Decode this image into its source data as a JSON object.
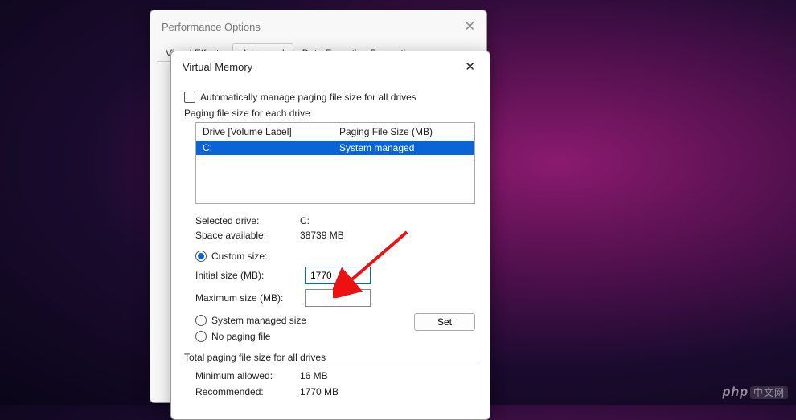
{
  "perf_window": {
    "title": "Performance Options",
    "tabs": [
      "Visual Effects",
      "Advanced",
      "Data Execution Prevention"
    ],
    "active_tab": 1
  },
  "vm_window": {
    "title": "Virtual Memory",
    "auto_manage_label": "Automatically manage paging file size for all drives",
    "group_label": "Paging file size for each drive",
    "header_drive": "Drive  [Volume Label]",
    "header_size": "Paging File Size (MB)",
    "drives": [
      {
        "drive": "C:",
        "size": "System managed",
        "selected": true
      }
    ],
    "selected_drive_label": "Selected drive:",
    "selected_drive_value": "C:",
    "space_label": "Space available:",
    "space_value": "38739 MB",
    "radio_custom": "Custom size:",
    "initial_label": "Initial size (MB):",
    "initial_value": "1770",
    "max_label": "Maximum size (MB):",
    "max_value": "",
    "radio_system": "System managed size",
    "radio_none": "No paging file",
    "set_btn": "Set",
    "total_label": "Total paging file size for all drives",
    "min_allowed_label": "Minimum allowed:",
    "min_allowed_value": "16 MB",
    "recommended_label": "Recommended:",
    "recommended_value": "1770 MB"
  },
  "watermark": {
    "brand": "php",
    "suffix": "中文网"
  }
}
